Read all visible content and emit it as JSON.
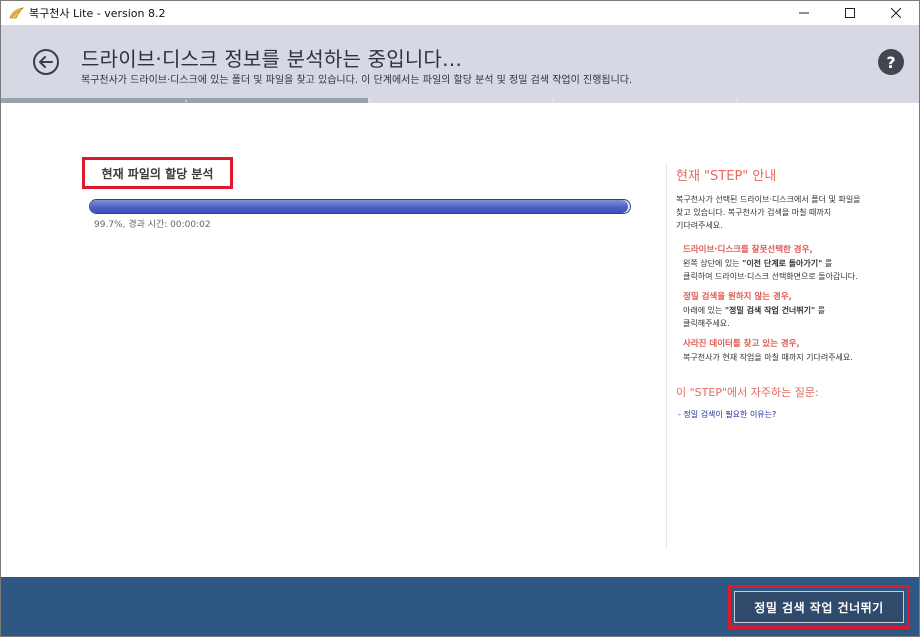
{
  "window": {
    "title": "복구천사 Lite - version 8.2",
    "controls": {
      "minimize": "—",
      "maximize": "☐",
      "close": "✕"
    }
  },
  "header": {
    "title": "드라이브·디스크 정보를 분석하는 중입니다…",
    "subtitle": "복구천사가 드라이브·디스크에 있는 폴더 및 파일을 찾고 있습니다. 이 단계에서는 파일의 할당 분석 및 정밀 검색 작업이 진행됩니다.",
    "help_label": "?"
  },
  "steps": {
    "total": 5,
    "completed": 2
  },
  "main": {
    "section_title": "현재 파일의 할당 분석",
    "progress": 0.997,
    "progress_text": "99.7%, 경과 시간: 00:00:02"
  },
  "guide": {
    "title": "현재 \"STEP\" 안내",
    "intro_line1": "복구천사가 선택된 드라이브·디스크에서 폴더 및 파일을",
    "intro_line2": "찾고 있습니다. 복구천사가 검색을 마칠 때까지",
    "intro_line3": "기다려주세요.",
    "case1_title": "드라이브·디스크를 잘못선택한 경우,",
    "case1_pre": "왼쪽 상단에 있는 ",
    "case1_bold": "\"이전 단계로 돌아가기\"",
    "case1_post": " 를",
    "case1_line2": "클릭하여 드라이브·디스크 선택화면으로 돌아갑니다.",
    "case2_title": "정밀 검색을 원하지 않는 경우,",
    "case2_pre": "아래에 있는 ",
    "case2_bold": "\"정밀 검색 작업 건너뛰기\"",
    "case2_post": " 를",
    "case2_line2": "클릭해주세요.",
    "case3_title": "사라진 데이터를 찾고 있는 경우,",
    "case3_line1": "복구천사가 현재 작업을 마칠 때까지 기다려주세요.",
    "faq_title": "이 \"STEP\"에서 자주하는 질문:",
    "faq_link": "- 정밀 검색이 필요한 이유는?"
  },
  "footer": {
    "skip_button": "정밀 검색 작업 건너뛰기"
  },
  "colors": {
    "header_bg": "#d6d9e4",
    "footer_bg": "#2e5883",
    "accent_red": "#e0182d",
    "guide_red": "#e05a52",
    "progress_blue": "#4d62c6"
  },
  "icons": {
    "app": "angel-wing-icon",
    "back": "back-arrow-icon",
    "help": "help-icon"
  }
}
